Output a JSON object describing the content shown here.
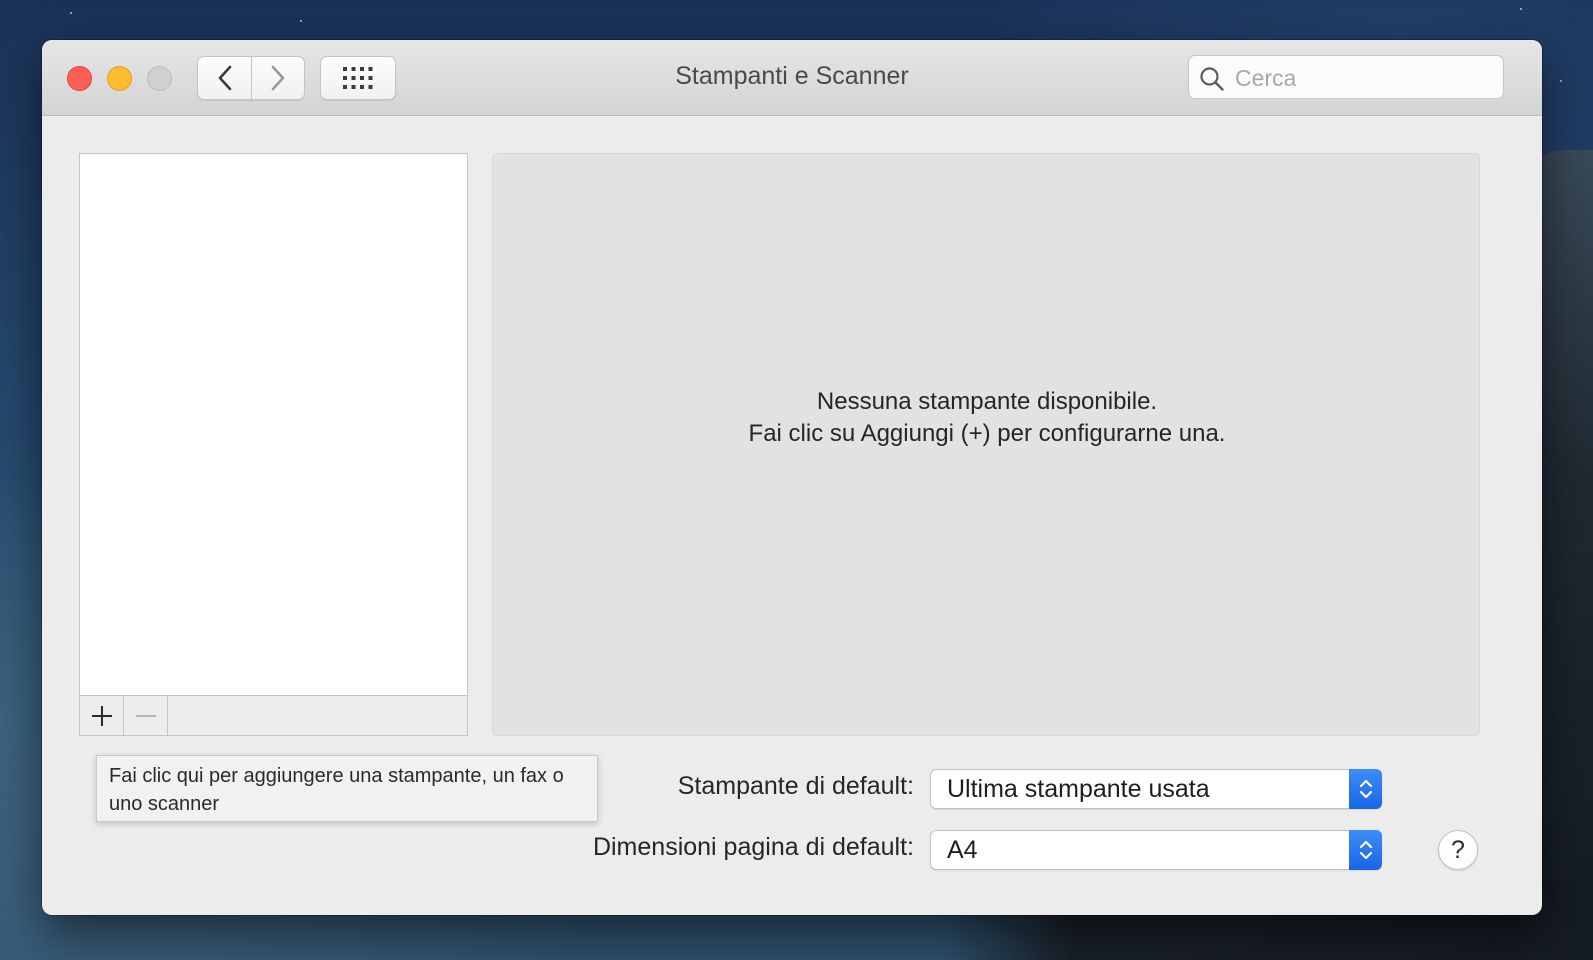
{
  "window": {
    "title": "Stampanti e Scanner"
  },
  "toolbar": {
    "back_icon": "chevron-left-icon",
    "forward_icon": "chevron-right-icon",
    "show_all_icon": "grid-icon"
  },
  "search": {
    "placeholder": "Cerca",
    "value": ""
  },
  "printer_list": {
    "items": [],
    "add_icon": "plus-icon",
    "remove_icon": "minus-icon"
  },
  "detail": {
    "empty_line1": "Nessuna stampante disponibile.",
    "empty_line2": "Fai clic su Aggiungi (+) per configurarne una."
  },
  "tooltip": {
    "text": "Fai clic qui per aggiungere una stampante, un fax o uno scanner"
  },
  "defaults": {
    "printer_label": "Stampante di default:",
    "printer_value": "Ultima stampante usata",
    "paper_label": "Dimensioni pagina di default:",
    "paper_value": "A4"
  },
  "help": {
    "label": "?"
  },
  "colors": {
    "accent": "#1a6ae8",
    "close": "#fe5f57",
    "minimize": "#febc2e",
    "zoom_disabled": "#d0d0d0"
  }
}
